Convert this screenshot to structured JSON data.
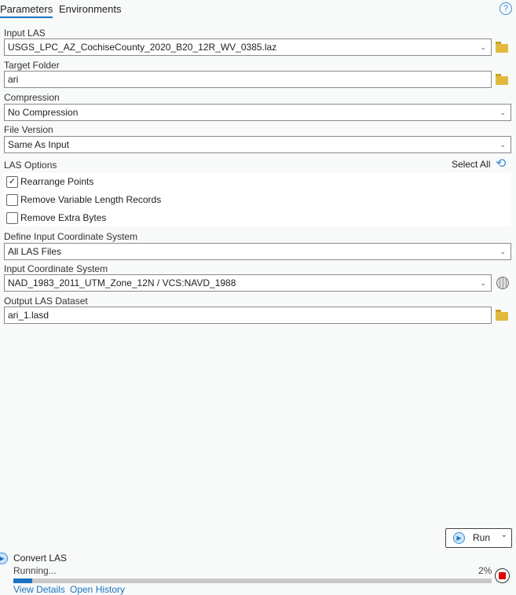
{
  "tabs": [
    "Parameters",
    "Environments"
  ],
  "params": {
    "input_las": {
      "label": "Input LAS",
      "value": "USGS_LPC_AZ_CochiseCounty_2020_B20_12R_WV_0385.laz"
    },
    "target_folder": {
      "label": "Target Folder",
      "value": "ari"
    },
    "compression": {
      "label": "Compression",
      "value": "No Compression"
    },
    "file_version": {
      "label": "File Version",
      "value": "Same As Input"
    },
    "las_options": {
      "label": "LAS Options",
      "select_all": "Select All",
      "items": [
        {
          "label": "Rearrange Points",
          "checked": true
        },
        {
          "label": "Remove Variable Length Records",
          "checked": false
        },
        {
          "label": "Remove Extra Bytes",
          "checked": false
        }
      ]
    },
    "define_cs": {
      "label": "Define Input Coordinate System",
      "value": "All LAS Files"
    },
    "input_cs": {
      "label": "Input Coordinate System",
      "value": "NAD_1983_2011_UTM_Zone_12N / VCS:NAVD_1988"
    },
    "output": {
      "label": "Output LAS Dataset",
      "value": "ari_1.lasd"
    }
  },
  "run_label": "Run",
  "job": {
    "title": "Convert LAS",
    "status": "Running...",
    "percent_text": "2%",
    "progress": 0.02,
    "links": [
      "View Details",
      "Open History"
    ]
  }
}
